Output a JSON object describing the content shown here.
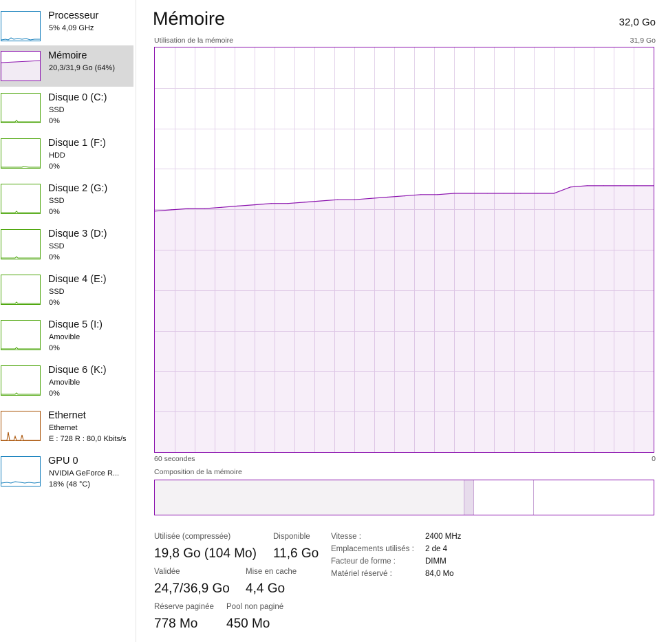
{
  "sidebar": {
    "items": [
      {
        "title": "Processeur",
        "line1": "5% 4,09 GHz",
        "line2": "",
        "color": "#117dbb",
        "selected": false,
        "icon": "cpu-graph-thumbnail"
      },
      {
        "title": "Mémoire",
        "line1": "20,3/31,9 Go (64%)",
        "line2": "",
        "color": "#8b12ae",
        "selected": true,
        "icon": "memory-graph-thumbnail"
      },
      {
        "title": "Disque 0 (C:)",
        "line1": "SSD",
        "line2": "0%",
        "color": "#4da60c",
        "selected": false,
        "icon": "disk-graph-thumbnail"
      },
      {
        "title": "Disque 1 (F:)",
        "line1": "HDD",
        "line2": "0%",
        "color": "#4da60c",
        "selected": false,
        "icon": "disk-graph-thumbnail"
      },
      {
        "title": "Disque 2 (G:)",
        "line1": "SSD",
        "line2": "0%",
        "color": "#4da60c",
        "selected": false,
        "icon": "disk-graph-thumbnail"
      },
      {
        "title": "Disque 3 (D:)",
        "line1": "SSD",
        "line2": "0%",
        "color": "#4da60c",
        "selected": false,
        "icon": "disk-graph-thumbnail"
      },
      {
        "title": "Disque 4 (E:)",
        "line1": "SSD",
        "line2": "0%",
        "color": "#4da60c",
        "selected": false,
        "icon": "disk-graph-thumbnail"
      },
      {
        "title": "Disque 5 (I:)",
        "line1": "Amovible",
        "line2": "0%",
        "color": "#4da60c",
        "selected": false,
        "icon": "disk-graph-thumbnail"
      },
      {
        "title": "Disque 6 (K:)",
        "line1": "Amovible",
        "line2": "0%",
        "color": "#4da60c",
        "selected": false,
        "icon": "disk-graph-thumbnail"
      },
      {
        "title": "Ethernet",
        "line1": "Ethernet",
        "line2": "E : 728 R : 80,0 Kbits/s",
        "color": "#a74f01",
        "selected": false,
        "icon": "network-graph-thumbnail"
      },
      {
        "title": "GPU 0",
        "line1": "NVIDIA GeForce R...",
        "line2": "18% (48 °C)",
        "color": "#117dbb",
        "selected": false,
        "icon": "gpu-graph-thumbnail"
      }
    ]
  },
  "main": {
    "title": "Mémoire",
    "total": "32,0 Go",
    "graph_caption": "Utilisation de la mémoire",
    "graph_max": "31,9 Go",
    "time_left": "60 secondes",
    "time_right": "0",
    "composition_caption": "Composition de la mémoire"
  },
  "chart_data": {
    "type": "area",
    "title": "Utilisation de la mémoire",
    "xlabel": "",
    "ylabel": "",
    "x_range_label": [
      "60 secondes",
      "0"
    ],
    "ylim": [
      0,
      31.9
    ],
    "grid": true,
    "color": "#8b12ae",
    "series": [
      {
        "x": [
          60,
          58,
          56,
          54,
          52,
          50,
          48,
          46,
          44,
          42,
          40,
          38,
          36,
          34,
          32,
          30,
          28,
          26,
          24,
          22,
          20,
          18,
          16,
          14,
          12,
          10,
          8,
          6,
          4,
          2,
          0
        ],
        "values": [
          19.0,
          19.1,
          19.2,
          19.2,
          19.3,
          19.4,
          19.5,
          19.6,
          19.6,
          19.7,
          19.8,
          19.9,
          19.9,
          20.0,
          20.1,
          20.2,
          20.3,
          20.3,
          20.4,
          20.4,
          20.4,
          20.4,
          20.4,
          20.4,
          20.4,
          20.9,
          21.0,
          21.0,
          21.0,
          21.0,
          21.0
        ]
      }
    ]
  },
  "composition": {
    "caption": "Composition de la mémoire",
    "segments": [
      {
        "name": "En cours d'utilisation",
        "fraction": 0.62,
        "fill": "#f4f2f4"
      },
      {
        "name": "Modifiée",
        "fraction": 0.02,
        "fill": "#e7dcec"
      },
      {
        "name": "En attente",
        "fraction": 0.12,
        "fill": "#ffffff"
      },
      {
        "name": "Libre",
        "fraction": 0.24,
        "fill": "#ffffff"
      }
    ]
  },
  "stats": {
    "used_label": "Utilisée (compressée)",
    "used_value": "19,8 Go (104 Mo)",
    "available_label": "Disponible",
    "available_value": "11,6 Go",
    "committed_label": "Validée",
    "committed_value": "24,7/36,9 Go",
    "cached_label": "Mise en cache",
    "cached_value": "4,4 Go",
    "paged_label": "Réserve paginée",
    "paged_value": "778 Mo",
    "nonpaged_label": "Pool non paginé",
    "nonpaged_value": "450 Mo"
  },
  "specs": {
    "speed_label": "Vitesse :",
    "speed_value": "2400 MHz",
    "slots_label": "Emplacements utilisés :",
    "slots_value": "2 de 4",
    "form_label": "Facteur de forme :",
    "form_value": "DIMM",
    "reserved_label": "Matériel réservé :",
    "reserved_value": "84,0 Mo"
  }
}
